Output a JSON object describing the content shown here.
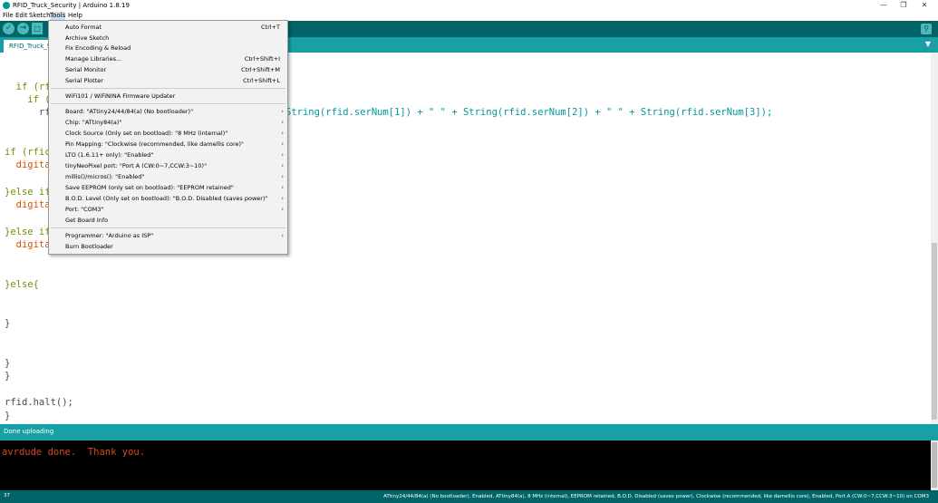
{
  "window": {
    "title": "RFID_Truck_Security | Arduino 1.8.19"
  },
  "menubar": [
    "File",
    "Edit",
    "Sketch",
    "Tools",
    "Help"
  ],
  "tab": {
    "label": "RFID_Truck_Security"
  },
  "editor": {
    "lines": [
      {
        "text": "  if (rfi"
      },
      {
        "text": "    if ("
      },
      {
        "text": "      rf"
      },
      {
        "text": "String(rfid.serNum[1]) + \" \" + String(rfid.serNum[2]) + \" \" + String(rfid.serNum[3]);"
      },
      {
        "text": "if (rfic"
      },
      {
        "text": "  digita"
      },
      {
        "text": "}else if"
      },
      {
        "text": "  digita"
      },
      {
        "text": "}else if"
      },
      {
        "text": "  digita"
      },
      {
        "text": "}else{"
      },
      {
        "text": "}"
      },
      {
        "text": "}"
      },
      {
        "text": "}"
      },
      {
        "text": "rfid.halt();"
      },
      {
        "text": "}"
      }
    ]
  },
  "tools_menu": {
    "items": [
      {
        "label": "Auto Format",
        "shortcut": "Ctrl+T"
      },
      {
        "label": "Archive Sketch",
        "shortcut": ""
      },
      {
        "label": "Fix Encoding & Reload",
        "shortcut": ""
      },
      {
        "label": "Manage Libraries...",
        "shortcut": "Ctrl+Shift+I"
      },
      {
        "label": "Serial Monitor",
        "shortcut": "Ctrl+Shift+M"
      },
      {
        "label": "Serial Plotter",
        "shortcut": "Ctrl+Shift+L"
      },
      {
        "label": "WiFi101 / WiFiNINA Firmware Updater",
        "shortcut": ""
      },
      {
        "label": "Board: \"ATtiny24/44/84(a) (No bootloader)\"",
        "shortcut": ""
      },
      {
        "label": "Chip: \"ATtiny84(a)\"",
        "shortcut": ""
      },
      {
        "label": "Clock Source (Only set on bootload): \"8 MHz (internal)\"",
        "shortcut": ""
      },
      {
        "label": "Pin Mapping: \"Clockwise (recommended, like damellis core)\"",
        "shortcut": ""
      },
      {
        "label": "LTO (1.6.11+ only): \"Enabled\"",
        "shortcut": ""
      },
      {
        "label": "tinyNeoPixel port: \"Port A (CW:0~7,CCW:3~10)\"",
        "shortcut": ""
      },
      {
        "label": "millis()/micros(): \"Enabled\"",
        "shortcut": ""
      },
      {
        "label": "Save EEPROM (only set on bootload): \"EEPROM retained\"",
        "shortcut": ""
      },
      {
        "label": "B.O.D. Level (Only set on bootload): \"B.O.D. Disabled (saves power)\"",
        "shortcut": ""
      },
      {
        "label": "Port: \"COM3\"",
        "shortcut": ""
      },
      {
        "label": "Get Board Info",
        "shortcut": ""
      },
      {
        "label": "Programmer: \"Arduino as ISP\"",
        "shortcut": ""
      },
      {
        "label": "Burn Bootloader",
        "shortcut": ""
      }
    ]
  },
  "status": {
    "text": "Done uploading"
  },
  "console": {
    "text": "avrdude done.  Thank you."
  },
  "bottombar": {
    "line_number": "37",
    "board_info": "ATtiny24/44/84(a) (No bootloader), Enabled, ATtiny84(a), 8 MHz (internal), EEPROM retained, B.O.D. Disabled (saves power), Clockwise (recommended, like damellis core), Enabled, Port A (CW:0~7,CCW:3~10) on COM3"
  },
  "colors": {
    "toolbar": "#006468",
    "tabbar": "#17a1a5",
    "console_text": "#d34a20"
  }
}
